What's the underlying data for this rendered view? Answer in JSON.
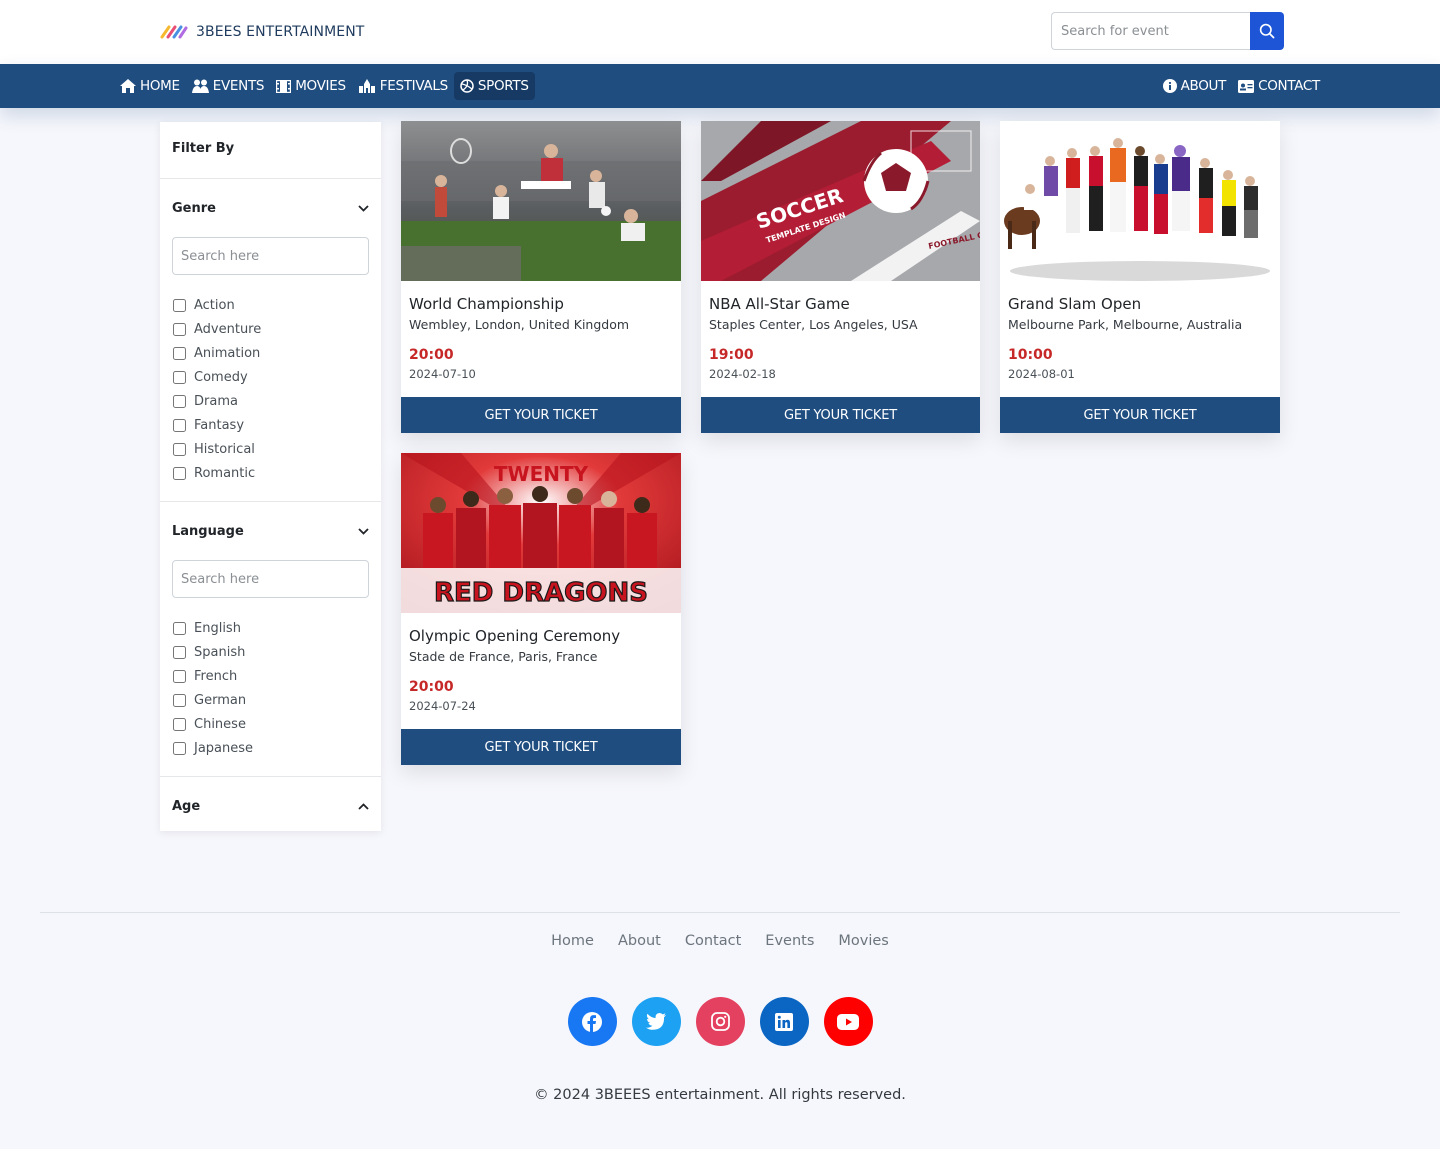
{
  "brand": {
    "name": "3BEES ENTERTAINMENT"
  },
  "search": {
    "placeholder": "Search for event"
  },
  "nav": {
    "left": [
      {
        "label": "HOME",
        "icon": "home-icon"
      },
      {
        "label": "EVENTS",
        "icon": "people-icon"
      },
      {
        "label": "MOVIES",
        "icon": "film-icon"
      },
      {
        "label": "FESTIVALS",
        "icon": "festival-icon"
      },
      {
        "label": "SPORTS",
        "icon": "volleyball-icon",
        "active": true
      }
    ],
    "right": [
      {
        "label": "ABOUT",
        "icon": "info-icon"
      },
      {
        "label": "CONTACT",
        "icon": "id-card-icon"
      }
    ]
  },
  "sidebar": {
    "title": "Filter By",
    "genre": {
      "title": "Genre",
      "placeholder": "Search here",
      "options": [
        "Action",
        "Adventure",
        "Animation",
        "Comedy",
        "Drama",
        "Fantasy",
        "Historical",
        "Romantic"
      ]
    },
    "language": {
      "title": "Language",
      "placeholder": "Search here",
      "options": [
        "English",
        "Spanish",
        "French",
        "German",
        "Chinese",
        "Japanese"
      ]
    },
    "age": {
      "title": "Age"
    }
  },
  "events": [
    {
      "title": "World Championship",
      "venue": "Wembley, London, United Kingdom",
      "time": "20:00",
      "date": "2024-07-10",
      "button": "GET YOUR TICKET"
    },
    {
      "title": "NBA All-Star Game",
      "venue": "Staples Center, Los Angeles, USA",
      "time": "19:00",
      "date": "2024-02-18",
      "button": "GET YOUR TICKET"
    },
    {
      "title": "Grand Slam Open",
      "venue": "Melbourne Park, Melbourne, Australia",
      "time": "10:00",
      "date": "2024-08-01",
      "button": "GET YOUR TICKET"
    },
    {
      "title": "Olympic Opening Ceremony",
      "venue": "Stade de France, Paris, France",
      "time": "20:00",
      "date": "2024-07-24",
      "button": "GET YOUR TICKET"
    }
  ],
  "card_images": {
    "soccer_title": "SOCCER",
    "soccer_sub": "TEMPLATE DESIGN",
    "soccer_badge": "FOOTBALL CUP",
    "dragons_top": "TWENTY",
    "dragons_title": "RED DRAGONS"
  },
  "footer": {
    "links": [
      "Home",
      "About",
      "Contact",
      "Events",
      "Movies"
    ],
    "socials": [
      {
        "name": "facebook-icon",
        "color": "#1877f2"
      },
      {
        "name": "twitter-icon",
        "color": "#1da1f2"
      },
      {
        "name": "instagram-icon",
        "color": "#e4405f"
      },
      {
        "name": "linkedin-icon",
        "color": "#0a66c2"
      },
      {
        "name": "youtube-icon",
        "color": "#ff0000"
      }
    ],
    "copyright": "© 2024 3BEEES entertainment. All rights reserved."
  }
}
